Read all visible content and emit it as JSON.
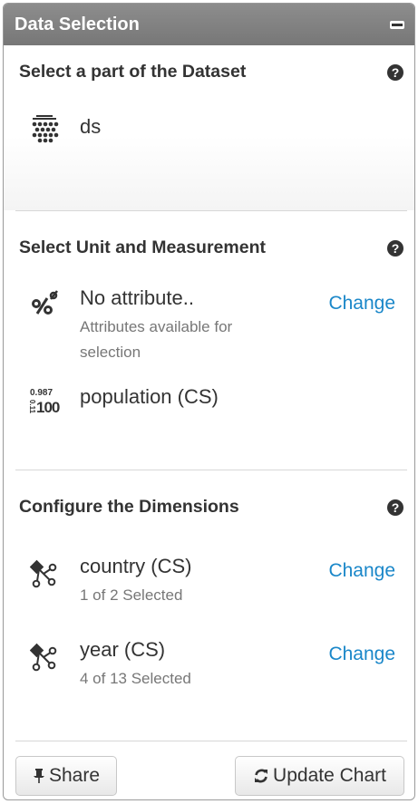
{
  "panel": {
    "title": "Data Selection"
  },
  "dataset_section": {
    "title": "Select a part of the Dataset",
    "help": "?",
    "dataset_name": "ds"
  },
  "unit_section": {
    "title": "Select Unit and Measurement",
    "help": "?",
    "attribute": {
      "label": "No attribute..",
      "sub": "Attributes available for selection",
      "change": "Change"
    },
    "measure": {
      "label": "population (CS)",
      "icon_text_top": "0.987",
      "icon_text_bottom": "100",
      "icon_text_side": "0.11"
    }
  },
  "dimension_section": {
    "title": "Configure the Dimensions",
    "help": "?",
    "dimensions": [
      {
        "label": "country (CS)",
        "sub": "1 of 2 Selected",
        "change": "Change"
      },
      {
        "label": "year (CS)",
        "sub": "4 of 13 Selected",
        "change": "Change"
      }
    ]
  },
  "footer": {
    "share_label": "Share",
    "update_label": "Update Chart"
  },
  "colors": {
    "link": "#1a87c9",
    "header": "#808080"
  }
}
